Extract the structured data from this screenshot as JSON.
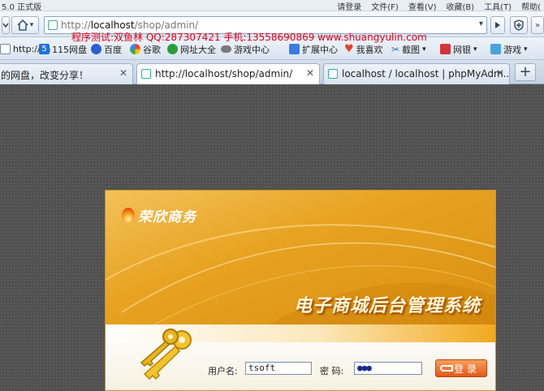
{
  "window": {
    "title_fragment": "5.0 正式版",
    "menus": [
      "请登录",
      "文件(F)",
      "查看(V)",
      "收藏(B)",
      "工具(T)",
      "帮助("
    ]
  },
  "address": {
    "url_prefix": "http://",
    "url_host": "localhost",
    "url_path": "/shop/admin/"
  },
  "overlay_text": "程序测试:双鱼林 QQ:287307421 手机:13558690869 www.shuangyulin.com",
  "favorites": [
    {
      "label": "http://sh",
      "icon": "page-icon"
    },
    {
      "label": "115网盘",
      "icon": "cloud-icon"
    },
    {
      "label": "百度",
      "icon": "baidu-paw-icon"
    },
    {
      "label": "谷歌",
      "icon": "google-icon"
    },
    {
      "label": "网址大全",
      "icon": "globe-icon"
    },
    {
      "label": "游戏中心",
      "icon": "gamepad-icon"
    },
    {
      "label": "扩展中心",
      "icon": "puzzle-icon"
    },
    {
      "label": "我喜欢",
      "icon": "heart-icon"
    },
    {
      "label": "截图",
      "icon": "scissors-icon"
    },
    {
      "label": "网银",
      "icon": "bank-icon"
    },
    {
      "label": "游戏",
      "icon": "game-icon"
    }
  ],
  "tabs": [
    {
      "label": "的网盘，改变分享！",
      "active": false
    },
    {
      "label": "http://localhost/shop/admin/",
      "active": true
    },
    {
      "label": "localhost / localhost | phpMyAdm...",
      "active": false
    }
  ],
  "new_tab": "+",
  "panel": {
    "brand": "荣欣商务",
    "system_title": "电子商城后台管理系统",
    "username_label": "用户名:",
    "username_value": "tsoft",
    "password_label": "密 码:",
    "password_value": "●●●",
    "login_button": "登录"
  },
  "colors": {
    "accent": "#e8a322",
    "overlay_red": "#e0001b",
    "login_button": "#e2581a"
  }
}
